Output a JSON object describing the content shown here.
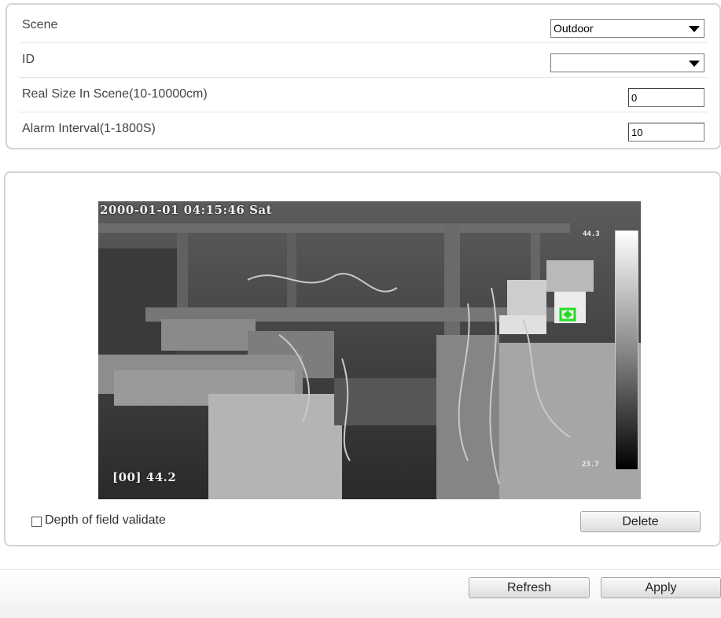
{
  "settings": {
    "scene": {
      "label": "Scene",
      "value": "Outdoor"
    },
    "id": {
      "label": "ID",
      "value": ""
    },
    "real_size": {
      "label": "Real Size In Scene(10-10000cm)",
      "value": "0"
    },
    "alarm_interval": {
      "label": "Alarm Interval(1-1800S)",
      "value": "10"
    }
  },
  "video": {
    "datetime": "2000-01-01 04:15:46 Sat",
    "reading": "[00] 44.2",
    "scale_max": "44.3",
    "scale_min": "23.7"
  },
  "controls": {
    "depth_validate_label": "Depth of field validate",
    "depth_validate_checked": false,
    "delete_label": "Delete"
  },
  "footer": {
    "refresh_label": "Refresh",
    "apply_label": "Apply"
  }
}
